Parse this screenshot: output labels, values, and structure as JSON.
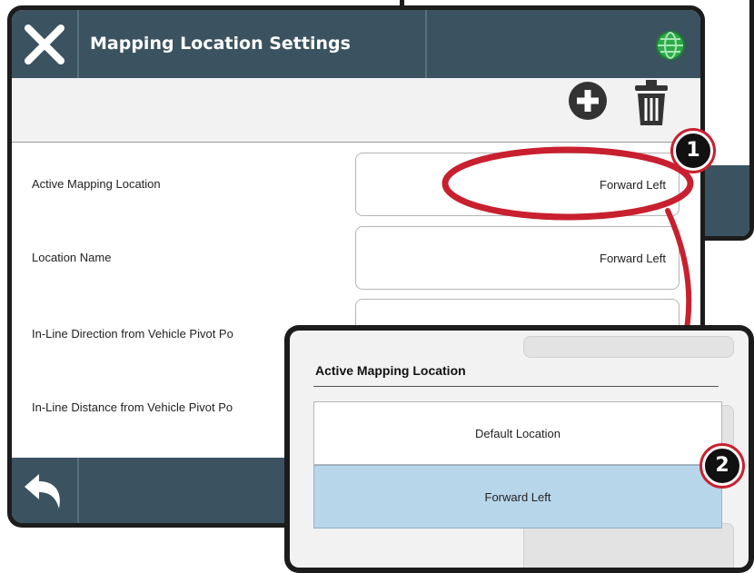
{
  "window": {
    "title": "Mapping Location Settings"
  },
  "toolbar": {
    "add_icon": "plus-circle-icon",
    "delete_icon": "trash-icon"
  },
  "rows": [
    {
      "label": "Active Mapping Location",
      "value": "Forward Left"
    },
    {
      "label": "Location Name",
      "value": "Forward Left"
    },
    {
      "label": "In-Line Direction from Vehicle Pivot Po",
      "value": ""
    },
    {
      "label": "In-Line Distance from Vehicle Pivot Po",
      "value": ""
    }
  ],
  "popup": {
    "title": "Active Mapping Location",
    "options": [
      {
        "label": "Default Location",
        "selected": false
      },
      {
        "label": "Forward Left",
        "selected": true
      }
    ]
  },
  "callouts": {
    "first": "1",
    "second": "2"
  },
  "colors": {
    "bar": "#3b5360",
    "highlight": "#c8202f",
    "selected": "#b8d6ea",
    "globe": "#2daa4a"
  }
}
